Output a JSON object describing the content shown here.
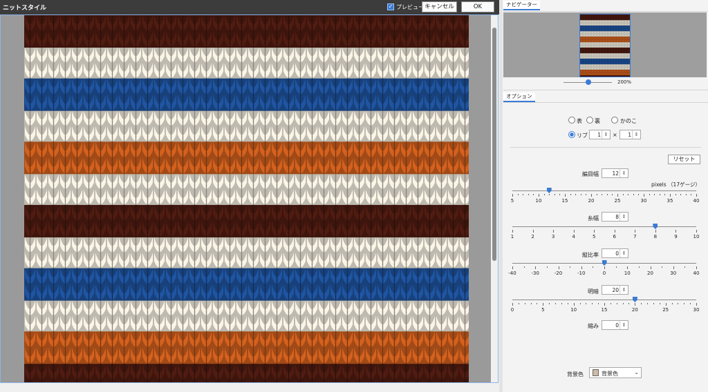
{
  "window": {
    "title": "ニットスタイル",
    "preview_label": "プレビュー",
    "preview_checked": true,
    "cancel_label": "キャンセル",
    "ok_label": "OK"
  },
  "canvas": {
    "stripes": [
      {
        "color": "#4a1a10",
        "name": "dark-brown"
      },
      {
        "color": "#e8e3d6",
        "name": "cream"
      },
      {
        "color": "#1d4f96",
        "name": "blue"
      },
      {
        "color": "#e8e3d6",
        "name": "cream"
      },
      {
        "color": "#c45a1c",
        "name": "orange"
      },
      {
        "color": "#e8e3d6",
        "name": "cream"
      },
      {
        "color": "#4a1a10",
        "name": "dark-brown"
      },
      {
        "color": "#e8e3d6",
        "name": "cream"
      },
      {
        "color": "#1d4f96",
        "name": "blue"
      },
      {
        "color": "#e8e3d6",
        "name": "cream"
      },
      {
        "color": "#c45a1c",
        "name": "orange"
      }
    ]
  },
  "navigator": {
    "tab_label": "ナビゲーター",
    "zoom_label": "200%",
    "zoom_fraction": 0.52
  },
  "options": {
    "tab_label": "オプション",
    "radios": [
      {
        "label": "表",
        "checked": false
      },
      {
        "label": "裏",
        "checked": false
      },
      {
        "label": "かのこ",
        "checked": false
      },
      {
        "label": "リブ",
        "checked": true
      }
    ],
    "rib_a": "1",
    "rib_sep": "×",
    "rib_b": "1",
    "reset_label": "リセット",
    "stitch_width": {
      "label": "編目幅",
      "value": "12",
      "unit_note": "pixels （17ゲージ）",
      "ticks": [
        "5",
        "10",
        "15",
        "20",
        "25",
        "30",
        "35",
        "40"
      ],
      "min": 5,
      "max": 40,
      "current": 12
    },
    "yarn_width": {
      "label": "糸幅",
      "value": "8",
      "ticks": [
        "1",
        "2",
        "3",
        "4",
        "5",
        "6",
        "7",
        "8",
        "9",
        "10"
      ],
      "min": 1,
      "max": 10,
      "current": 8
    },
    "aspect_ratio": {
      "label": "縦比率",
      "value": "0",
      "ticks": [
        "-40",
        "-30",
        "-20",
        "-10",
        "0",
        "10",
        "20",
        "30",
        "40"
      ],
      "min": -40,
      "max": 40,
      "current": 0
    },
    "contrast": {
      "label": "明暗",
      "value": "20",
      "ticks": [
        "0",
        "5",
        "10",
        "15",
        "20",
        "25",
        "30"
      ],
      "min": 0,
      "max": 30,
      "current": 20
    },
    "twist": {
      "label": "縮み",
      "value": "0"
    },
    "background": {
      "label": "背景色",
      "select_label": "背景色",
      "swatch_color": "#cdbba6"
    }
  }
}
